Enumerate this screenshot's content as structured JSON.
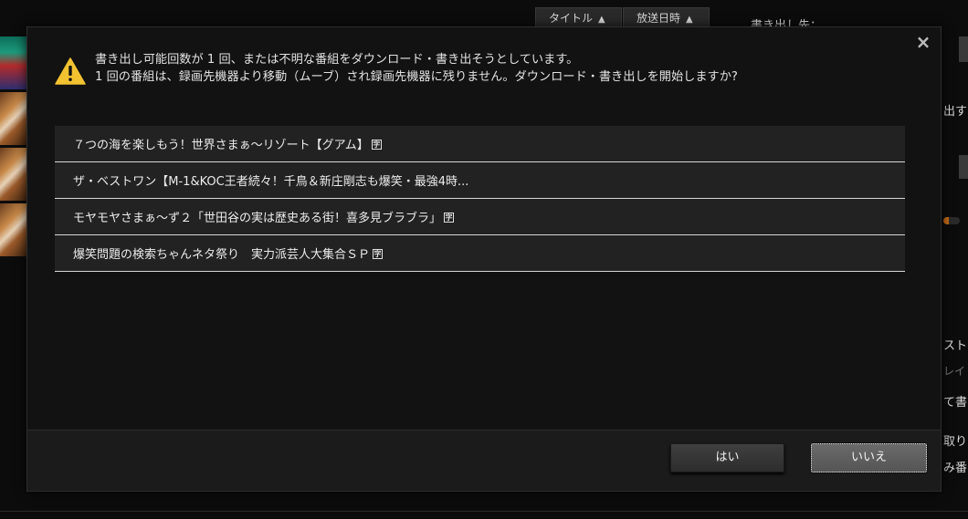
{
  "background": {
    "sort_buttons": [
      {
        "label": "タイトル"
      },
      {
        "label": "放送日時"
      }
    ],
    "fragments": {
      "export_to": "書き出し先：",
      "export": "出す",
      "list": "スト",
      "layout": "レイト",
      "export2": "て書",
      "capture": "取り出",
      "program": "み番"
    }
  },
  "dialog": {
    "close_label": "×",
    "icon": "warning-icon",
    "message_line1": "書き出し可能回数が 1 回、または不明な番組をダウンロード・書き出そうとしています。",
    "message_line2": "1 回の番組は、録画先機器より移動（ムーブ）され録画先機器に残りません。ダウンロード・書き出しを開始しますか?",
    "programs": [
      {
        "title": "７つの海を楽しもう！世界さまぁ～リゾート【グアム】",
        "caption_mark": "字"
      },
      {
        "title": "ザ・ベストワン【M-1&KOC王者続々！千鳥＆新庄剛志も爆笑・最強4時...",
        "caption_mark": ""
      },
      {
        "title": "モヤモヤさまぁ～ず２「世田谷の実は歴史ある街！喜多見ブラブラ」",
        "caption_mark": "字"
      },
      {
        "title": "爆笑問題の検索ちゃんネタ祭り　実力派芸人大集合ＳＰ",
        "caption_mark": "字"
      }
    ],
    "yes_label": "はい",
    "no_label": "いいえ"
  },
  "colors": {
    "warning": "#f2c230",
    "dialog_bg": "#121212",
    "accent_orange": "#c26a16"
  }
}
